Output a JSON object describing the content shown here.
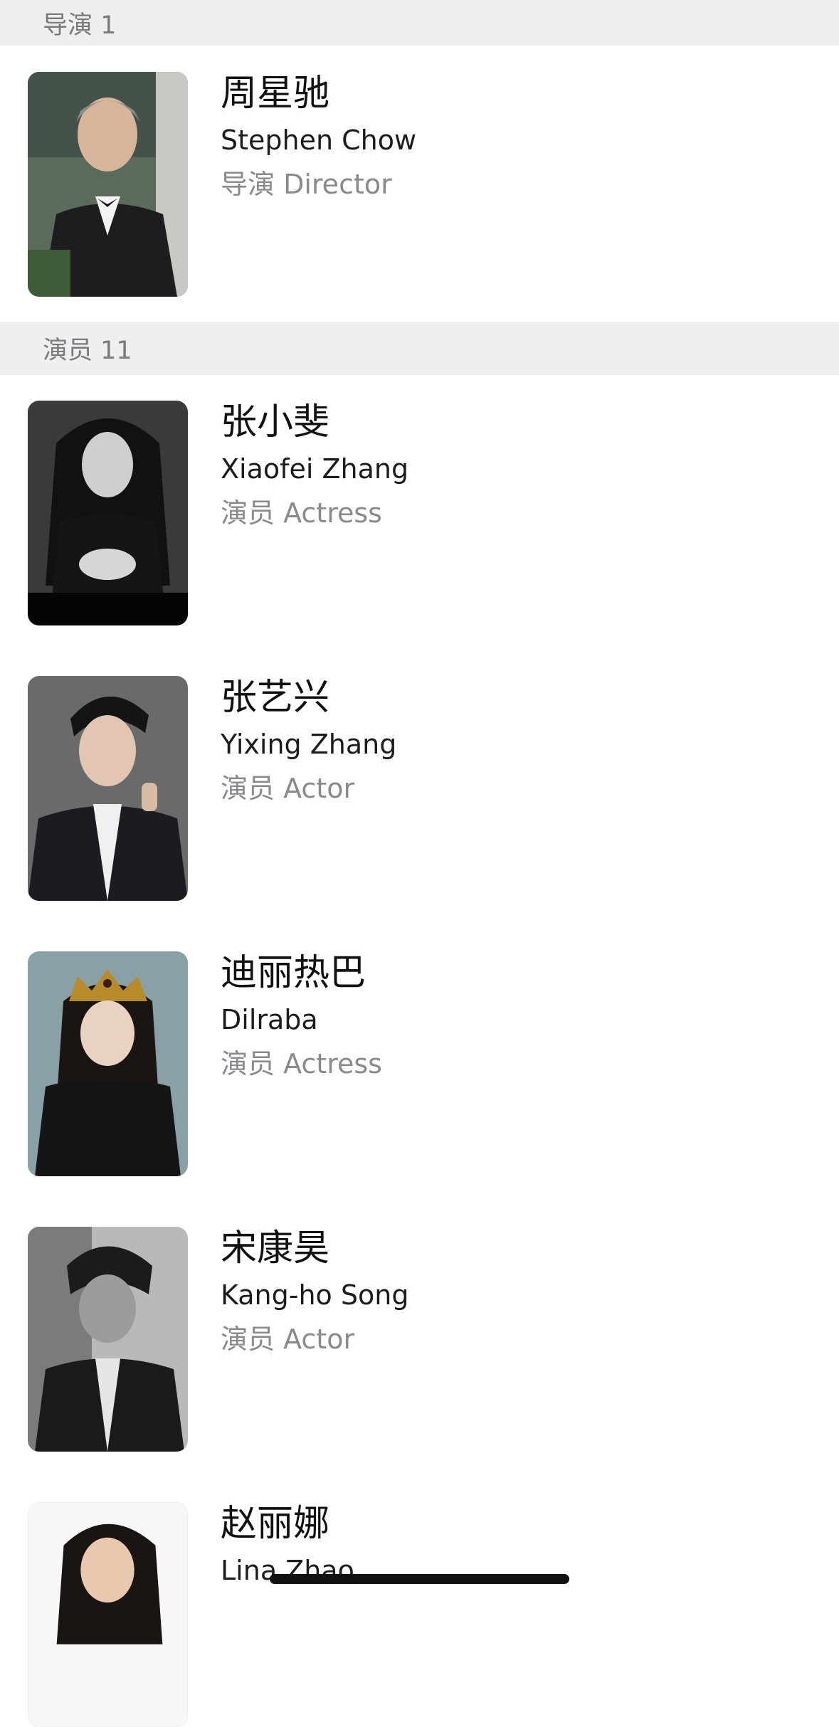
{
  "sections": {
    "directors": {
      "header": "导演 1"
    },
    "cast": {
      "header": "演员 11"
    }
  },
  "people": [
    {
      "name_cn": "周星驰",
      "name_en": "Stephen Chow",
      "role": "导演 Director"
    },
    {
      "name_cn": "张小斐",
      "name_en": "Xiaofei Zhang",
      "role": "演员 Actress"
    },
    {
      "name_cn": "张艺兴",
      "name_en": "Yixing Zhang",
      "role": "演员 Actor"
    },
    {
      "name_cn": "迪丽热巴",
      "name_en": "Dilraba",
      "role": "演员 Actress"
    },
    {
      "name_cn": "宋康昊",
      "name_en": "Kang-ho Song",
      "role": "演员 Actor"
    },
    {
      "name_cn": "赵丽娜",
      "name_en": "Lina Zhao",
      "role": ""
    }
  ],
  "colors": {
    "section_bg": "#efeff0",
    "section_text": "#7a7a7e",
    "primary_text": "#111111",
    "secondary_text": "#8a8a8e"
  }
}
